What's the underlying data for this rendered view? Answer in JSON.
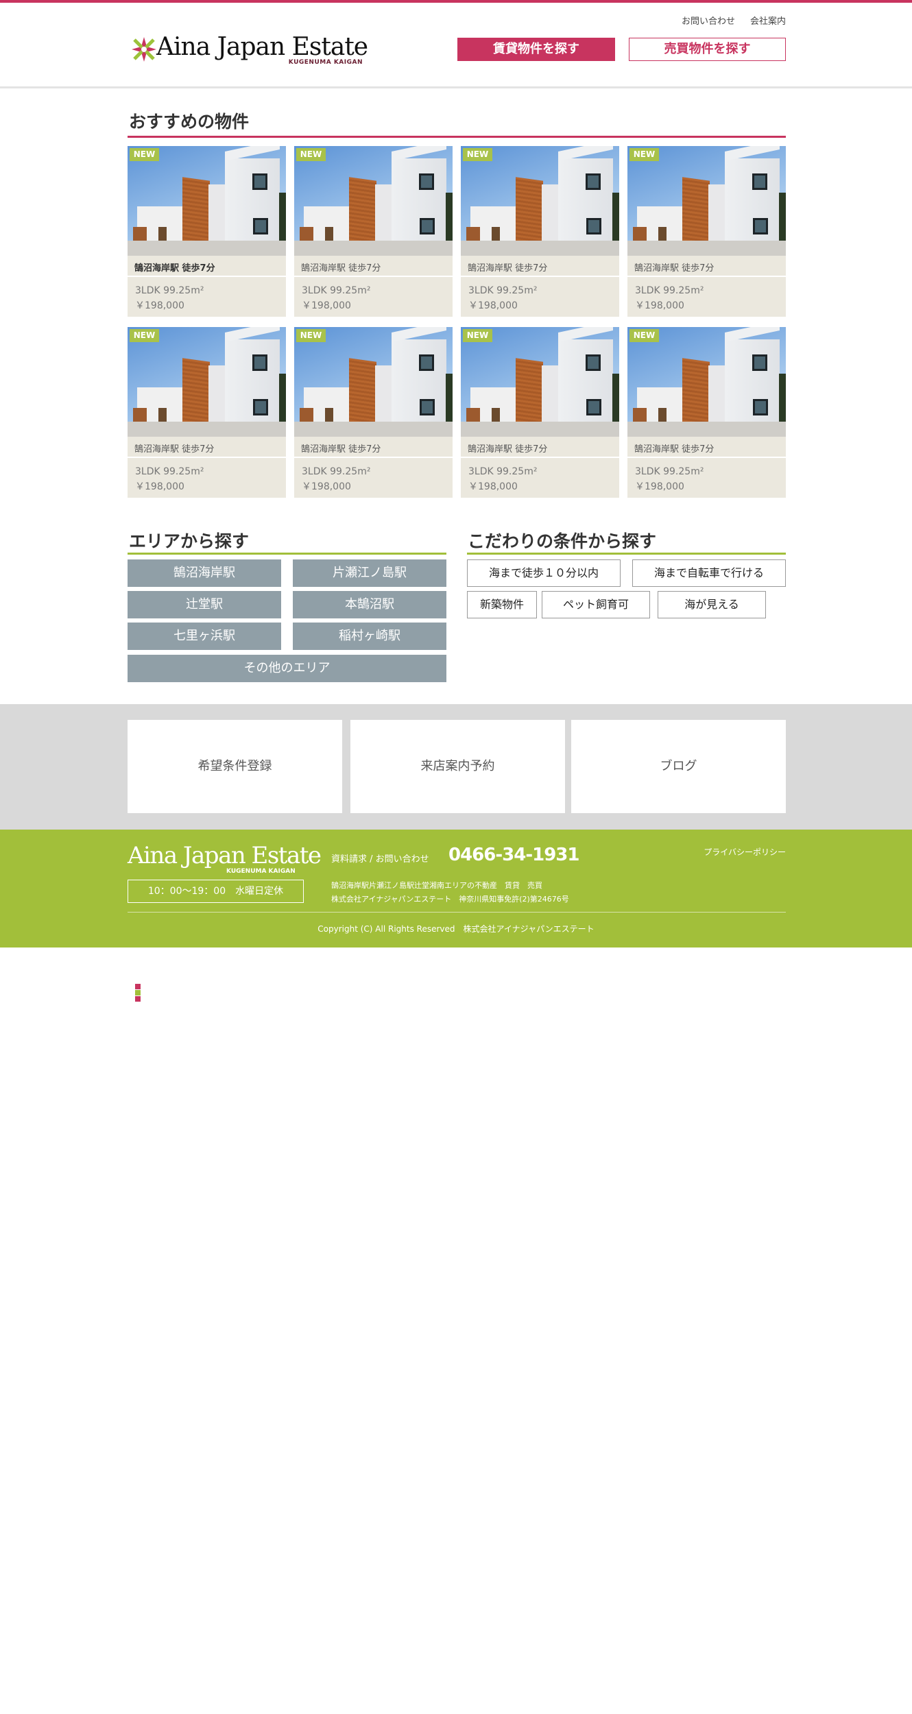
{
  "header": {
    "links": [
      "お問い合わせ",
      "会社案内"
    ],
    "logo": {
      "name": "Aina Japan Estate",
      "sub": "KUGENUMA KAIGAN"
    },
    "rent_button": "賃貸物件を探す",
    "sale_button": "売買物件を探す"
  },
  "featured": {
    "title": "おすすめの物件",
    "badge": "NEW",
    "items": [
      {
        "title": "鵠沼海岸駅 徒歩7分",
        "spec": "3LDK 99.25m²",
        "price": "￥198,000"
      },
      {
        "title": "鵠沼海岸駅 徒歩7分",
        "spec": "3LDK 99.25m²",
        "price": "￥198,000"
      },
      {
        "title": "鵠沼海岸駅 徒歩7分",
        "spec": "3LDK 99.25m²",
        "price": "￥198,000"
      },
      {
        "title": "鵠沼海岸駅 徒歩7分",
        "spec": "3LDK 99.25m²",
        "price": "￥198,000"
      },
      {
        "title": "鵠沼海岸駅 徒歩7分",
        "spec": "3LDK 99.25m²",
        "price": "￥198,000"
      },
      {
        "title": "鵠沼海岸駅 徒歩7分",
        "spec": "3LDK 99.25m²",
        "price": "￥198,000"
      },
      {
        "title": "鵠沼海岸駅 徒歩7分",
        "spec": "3LDK 99.25m²",
        "price": "￥198,000"
      },
      {
        "title": "鵠沼海岸駅 徒歩7分",
        "spec": "3LDK 99.25m²",
        "price": "￥198,000"
      }
    ]
  },
  "area": {
    "title": "エリアから探す",
    "items": [
      "鵠沼海岸駅",
      "片瀬江ノ島駅",
      "辻堂駅",
      "本鵠沼駅",
      "七里ヶ浜駅",
      "稲村ヶ崎駅",
      "その他のエリア"
    ]
  },
  "conditions": {
    "title": "こだわりの条件から探す",
    "items": [
      "海まで徒歩１０分以内",
      "海まで自転車で行ける",
      "新築物件",
      "ペット飼育可",
      "海が見える"
    ]
  },
  "links": [
    "希望条件登録",
    "来店案内予約",
    "ブログ"
  ],
  "footer": {
    "logo": {
      "name": "Aina Japan Estate",
      "sub": "KUGENUMA KAIGAN"
    },
    "hours": "10：00～19：00　水曜日定休",
    "contact_label": "資料請求 / お問い合わせ",
    "phone": "0466-34-1931",
    "privacy": "プライバシーポリシー",
    "address_lines": [
      "鵠沼海岸駅片瀬江ノ島駅辻堂湘南エリアの不動産　賃貸　売買",
      "株式会社アイナジャパンエステート　神奈川県知事免許(2)第24676号"
    ],
    "copyright": "Copyright (C) All Rights Reserved　株式会社アイナジャパンエステート"
  },
  "colors": {
    "brand_pink": "#c8345f",
    "brand_green": "#a2bf3a",
    "area_gray": "#909fa7"
  }
}
